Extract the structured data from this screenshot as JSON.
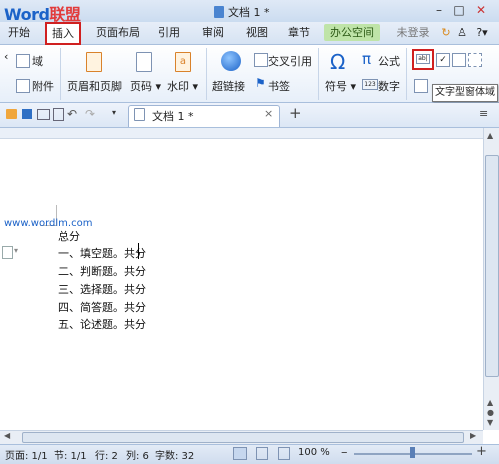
{
  "watermark": {
    "word": "Word",
    "lianmeng": "联盟",
    "url": "www.wordlm.com"
  },
  "window": {
    "title": "文档 1 *",
    "login": "未登录"
  },
  "menu": [
    "开始",
    "插入",
    "页面布局",
    "引用",
    "审阅",
    "视图",
    "章节",
    "办公空间"
  ],
  "ribbon": {
    "field": "域",
    "attachment": "附件",
    "header_footer": "页眉和页脚",
    "page_number": "页码",
    "watermark_btn": "水印",
    "hyperlink": "超链接",
    "cross_ref": "交叉引用",
    "bookmark": "书签",
    "symbol": "符号",
    "formula": "公式",
    "number": "数字"
  },
  "tooltip": "文字型窗体域",
  "doc_tab": "文档 1 *",
  "document_lines": [
    "总分",
    "一、填空题。共分",
    "二、判断题。共分",
    "三、选择题。共分",
    "四、简答题。共分",
    "五、论述题。共分"
  ],
  "status": {
    "page": "页面: 1/1",
    "section": "节: 1/1",
    "row": "行: 2",
    "col": "列: 6",
    "chars": "字数: 32",
    "zoom": "100 %"
  },
  "colors": {
    "accent": "#1b62c8",
    "highlight_red": "#d02020",
    "office_green": "#bfe4a8"
  }
}
